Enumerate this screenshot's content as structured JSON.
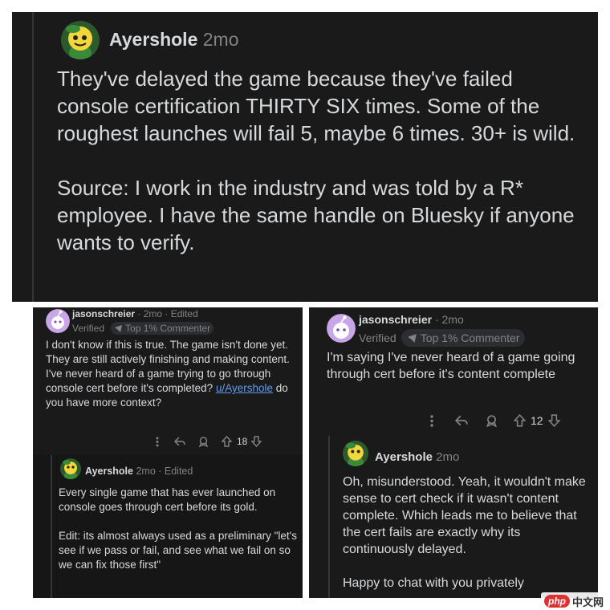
{
  "panel_top": {
    "username": "Ayershole",
    "age": "2mo",
    "paragraphs": [
      "They've delayed the game because they've failed console certification THIRTY SIX times. Some of the roughest launches will fail 5, maybe 6 times. 30+ is wild.",
      "Source: I work in the industry and was told by a R* employee. I have the same handle on Bluesky if anyone wants to verify."
    ]
  },
  "panel_left": {
    "comment1": {
      "username": "jasonschreier",
      "meta": "· 2mo · Edited",
      "verified": "Verified",
      "badge": "Top 1% Commenter",
      "body_before_link": "I don't know if this is true. The game isn't done yet. They are still actively finishing and making content. I've never heard of a game trying to go through console cert before it's completed? ",
      "link": "u/Ayershole",
      "body_after_link": " do you have more context?",
      "votes": "18"
    },
    "comment2": {
      "username": "Ayershole",
      "meta": "2mo · Edited",
      "paragraphs": [
        "Every single game that has ever launched on console goes through cert before its gold.",
        "Edit: its almost always used as a preliminary \"let's see if we pass or fail, and see what we fail on so we can fix those first\""
      ]
    }
  },
  "panel_right": {
    "comment1": {
      "username": "jasonschreier",
      "meta": "· 2mo",
      "verified": "Verified",
      "badge": "Top 1% Commenter",
      "body": "I'm saying I've never heard of a game going through cert before it's content complete",
      "votes": "12"
    },
    "comment2": {
      "username": "Ayershole",
      "meta": "2mo",
      "paragraphs": [
        "Oh, misunderstood. Yeah, it wouldn't make sense to cert check if it wasn't content complete. Which leads me to believe that the cert fails are exactly why its continuously delayed.",
        "Happy to chat with you privately"
      ]
    }
  },
  "watermark": {
    "logo": "php",
    "text": "中文网"
  },
  "icons": [
    "avatar-ayershole",
    "avatar-jasonschreier",
    "more-icon",
    "reply-icon",
    "award-icon",
    "upvote-icon",
    "downvote-icon",
    "badge-icon"
  ],
  "colors": {
    "background": "#1a1a1b",
    "text": "#d7dadc",
    "muted": "#818384",
    "link": "#5d9cec",
    "avatar_yellow": "#f2d63a",
    "avatar_green": "#3a8a3a",
    "avatar_purple": "#c9a6e8"
  }
}
